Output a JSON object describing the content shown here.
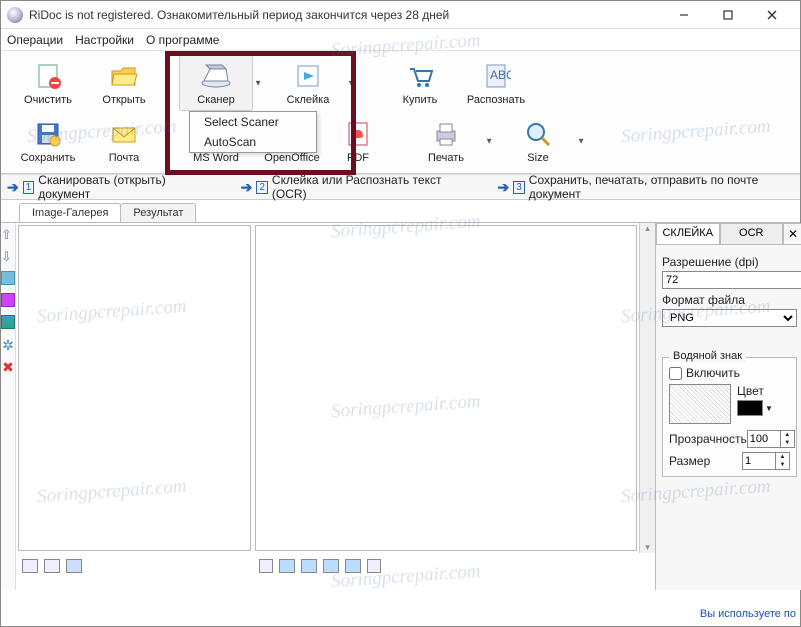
{
  "title": "RiDoc is not registered. Ознакомительный период закончится через 28 дней",
  "menu": {
    "ops": "Операции",
    "settings": "Настройки",
    "about": "О программе"
  },
  "toolbar": {
    "clear": "Очистить",
    "open": "Открыть",
    "scanner": "Сканер",
    "stitch": "Склейка",
    "buy": "Купить",
    "ocr": "Распознать",
    "save": "Сохранить",
    "mail": "Почта",
    "word": "MS Word",
    "oo": "OpenOffice",
    "pdf": "PDF",
    "print": "Печать",
    "size": "Size"
  },
  "scanner_menu": {
    "select": "Select Scaner",
    "auto": "AutoScan"
  },
  "steps": {
    "s1": "Сканировать (открыть) документ",
    "s2": "Склейка или Распознать текст (OCR)",
    "s3": "Сохранить, печатать, отправить по почте документ"
  },
  "tabs": {
    "gallery": "Image-Галерея",
    "result": "Результат"
  },
  "right": {
    "tab_stitch": "СКЛЕЙКА",
    "tab_ocr": "OCR",
    "res_label": "Разрешение (dpi)",
    "res_value": "72",
    "fmt_label": "Формат файла",
    "fmt_value": "PNG",
    "wm_legend": "Водяной знак",
    "wm_enable": "Включить",
    "color_label": "Цвет",
    "opacity_label": "Прозрачность",
    "opacity_value": "100",
    "size_label": "Размер",
    "size_value": "1"
  },
  "status": "Вы используете по",
  "watermark_text": "Soringpcrepair.com"
}
